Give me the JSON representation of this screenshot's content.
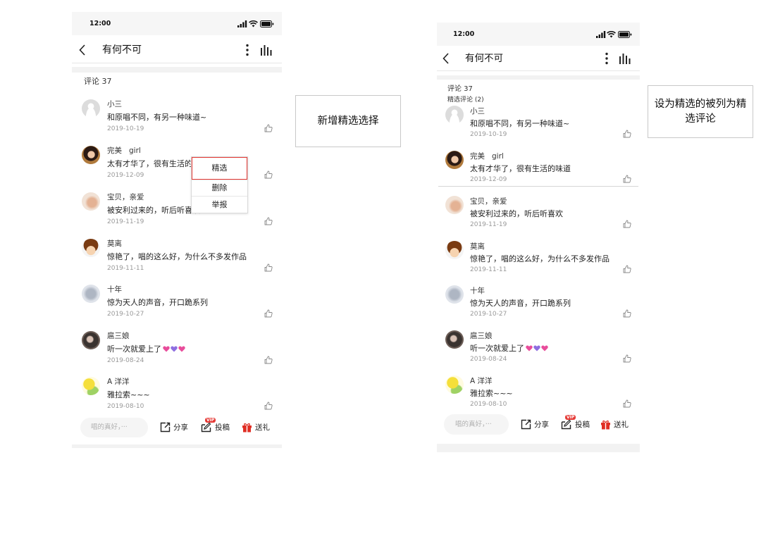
{
  "screens": {
    "before": {
      "status_time": "12:00",
      "title": "有何不可",
      "comment_count": "评论 37",
      "popup_menu": [
        "精选",
        "删除",
        "举报"
      ]
    },
    "after": {
      "status_time": "12:00",
      "title": "有何不可",
      "comment_count": "评论 37",
      "featured_label": "精选评论 (2)"
    }
  },
  "comments": [
    {
      "name": "小三",
      "text": "和原唱不同，有另一种味道~",
      "date": "2019-10-19"
    },
    {
      "name": "完美   girl",
      "text": "太有才华了，很有生活的味道",
      "date": "2019-12-09"
    },
    {
      "name": "宝贝，亲爱",
      "text": "被安利过来的，听后听喜欢",
      "date": "2019-11-19"
    },
    {
      "name": "莫离",
      "text": "惊艳了，唱的这么好，为什么不多发作品",
      "date": "2019-11-11"
    },
    {
      "name": "十年",
      "text": "惊为天人的声音，开口跪系列",
      "date": "2019-10-27"
    },
    {
      "name": "扈三娘",
      "text": "听一次就爱上了",
      "date": "2019-08-24",
      "emoji_icons": [
        "heart-emoji-icon",
        "heart-emoji-icon",
        "heart-emoji-icon"
      ]
    },
    {
      "name": "A 洋洋",
      "text": "雅拉索~~~",
      "date": "2019-08-10"
    }
  ],
  "bottom_bar": {
    "input_placeholder": "唱的真好，···",
    "share": "分享",
    "submit": "投稿",
    "submit_badge": "VIP",
    "gift": "送礼"
  },
  "annotations": [
    "新增精选选择",
    "设为精选的被列为精选评论"
  ],
  "colors": {
    "accent_red": "#e53935",
    "gift_red": "#e02e24",
    "date_text": "#999999",
    "placeholder_text": "#b0b0b0",
    "band_gray": "#f2f2f2"
  }
}
